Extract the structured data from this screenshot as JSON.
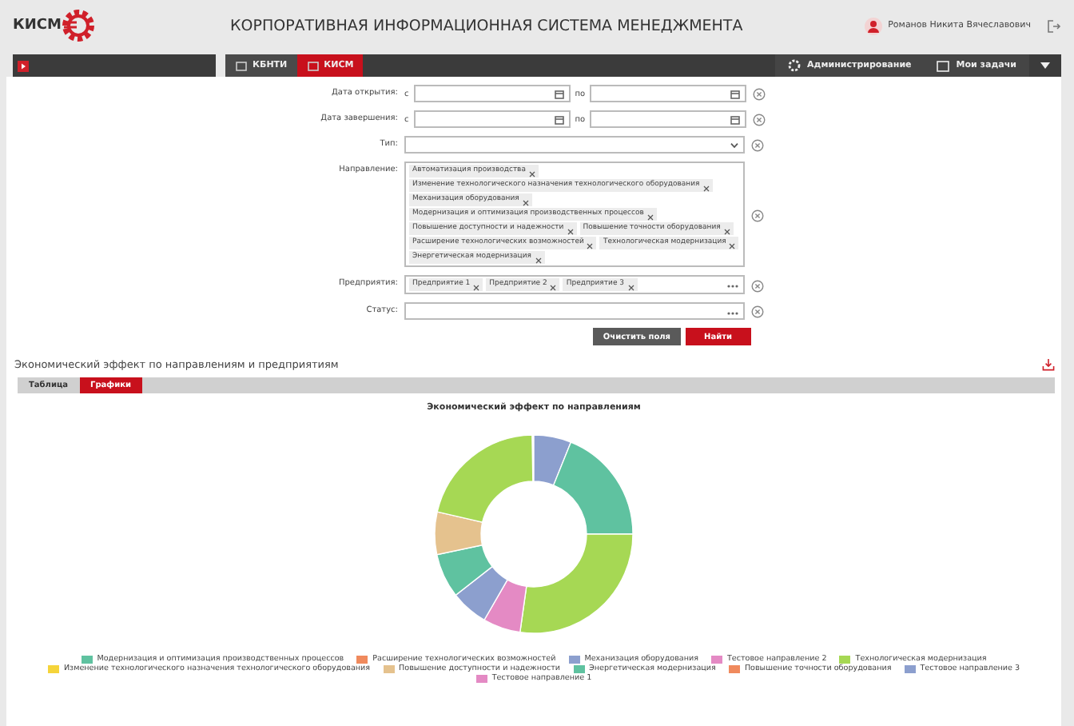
{
  "header": {
    "logo": "КИСМ",
    "title": "КОРПОРАТИВНАЯ ИНФОРМАЦИОННАЯ СИСТЕМА МЕНЕДЖМЕНТА",
    "user": "Романов Никита Вячеславович"
  },
  "nav": {
    "tabs": [
      {
        "label": "КБНТИ",
        "selected": false
      },
      {
        "label": "КИСМ",
        "selected": true
      }
    ],
    "admin": "Администрирование",
    "tasks": "Мои задачи"
  },
  "filters": [
    {
      "kind": "daterange",
      "label": "Дата открытия:",
      "from": "с",
      "to": "по"
    },
    {
      "kind": "daterange",
      "label": "Дата завершения:",
      "from": "с",
      "to": "по"
    },
    {
      "kind": "select",
      "label": "Тип:"
    },
    {
      "kind": "tags",
      "label": "Направление:",
      "tags": [
        [
          "Автоматизация производства"
        ],
        [
          "Изменение технологического назначения технологического оборудования"
        ],
        [
          "Механизация оборудования"
        ],
        [
          "Модернизация и оптимизация производственных процессов"
        ],
        [
          "Повышение доступности и надежности",
          "Повышение точности оборудования"
        ],
        [
          "Расширение технологических возможностей",
          "Технологическая модернизация"
        ],
        [
          "Энергетическая модернизация"
        ]
      ]
    },
    {
      "kind": "tags",
      "label": "Предприятия:",
      "tags": [
        [
          "Предприятие 1",
          "Предприятие 2",
          "Предприятие 3"
        ]
      ]
    },
    {
      "kind": "tags",
      "label": "Статус:"
    }
  ],
  "buttons": {
    "clear": "Очистить поля",
    "find": "Найти"
  },
  "section": {
    "title": "Экономический эффект по направлениям и предприятиям",
    "tabs": [
      {
        "label": "Таблица",
        "selected": false
      },
      {
        "label": "Графики",
        "selected": true
      }
    ],
    "chart_title": "Экономический эффект по направлениям"
  },
  "legend": [
    {
      "label": "Модернизация и оптимизация производственных процессов",
      "color": "#5fc2a0"
    },
    {
      "label": "Расширение технологических возможностей",
      "color": "#f08a5d"
    },
    {
      "label": "Механизация оборудования",
      "color": "#8c9fce"
    },
    {
      "label": "Тестовое направление 2",
      "color": "#e48ac4"
    },
    {
      "label": "Технологическая модернизация",
      "color": "#a6d854"
    },
    {
      "label": "Изменение технологического назначения технологического оборудования",
      "color": "#f5d43a"
    },
    {
      "label": "Повышение доступности и надежности",
      "color": "#e5c28e"
    },
    {
      "label": "Энергетическая модернизация",
      "color": "#5fc2a0"
    },
    {
      "label": "Повышение точности оборудования",
      "color": "#f08a5d"
    },
    {
      "label": "Тестовое направление 3",
      "color": "#8c9fce"
    },
    {
      "label": "Тестовое направление 1",
      "color": "#e48ac4"
    }
  ]
}
